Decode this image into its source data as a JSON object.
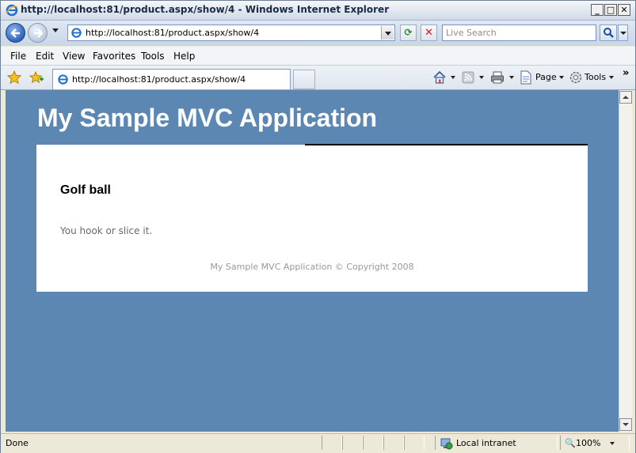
{
  "window": {
    "title": "http://localhost:81/product.aspx/show/4 - Windows Internet Explorer",
    "minimize_glyph": "_",
    "maximize_glyph": "□",
    "close_glyph": "✕"
  },
  "address_bar": {
    "url": "http://localhost:81/product.aspx/show/4"
  },
  "search": {
    "placeholder": "Live Search"
  },
  "menu": {
    "items": [
      "File",
      "Edit",
      "View",
      "Favorites",
      "Tools",
      "Help"
    ]
  },
  "tab": {
    "label": "http://localhost:81/product.aspx/show/4"
  },
  "command_bar": {
    "page_label": "Page",
    "tools_label": "Tools",
    "more_glyph": "»"
  },
  "page": {
    "site_title": "My Sample MVC Application",
    "product_name": "Golf ball",
    "product_description": "You hook or slice it.",
    "footer": "My Sample MVC Application © Copyright 2008"
  },
  "status_bar": {
    "status": "Done",
    "zone": "Local intranet",
    "zoom": "100%"
  },
  "colors": {
    "page_background": "#5c87b2",
    "panel_background": "#ffffff",
    "footer_text": "#999999"
  },
  "icons": [
    "ie-logo-icon",
    "back-arrow-icon",
    "forward-arrow-icon",
    "refresh-icon",
    "stop-icon",
    "search-icon",
    "favorites-star-icon",
    "add-favorites-icon",
    "home-icon",
    "feeds-icon",
    "print-icon",
    "page-icon",
    "gear-icon",
    "zone-globe-icon",
    "zoom-icon"
  ]
}
